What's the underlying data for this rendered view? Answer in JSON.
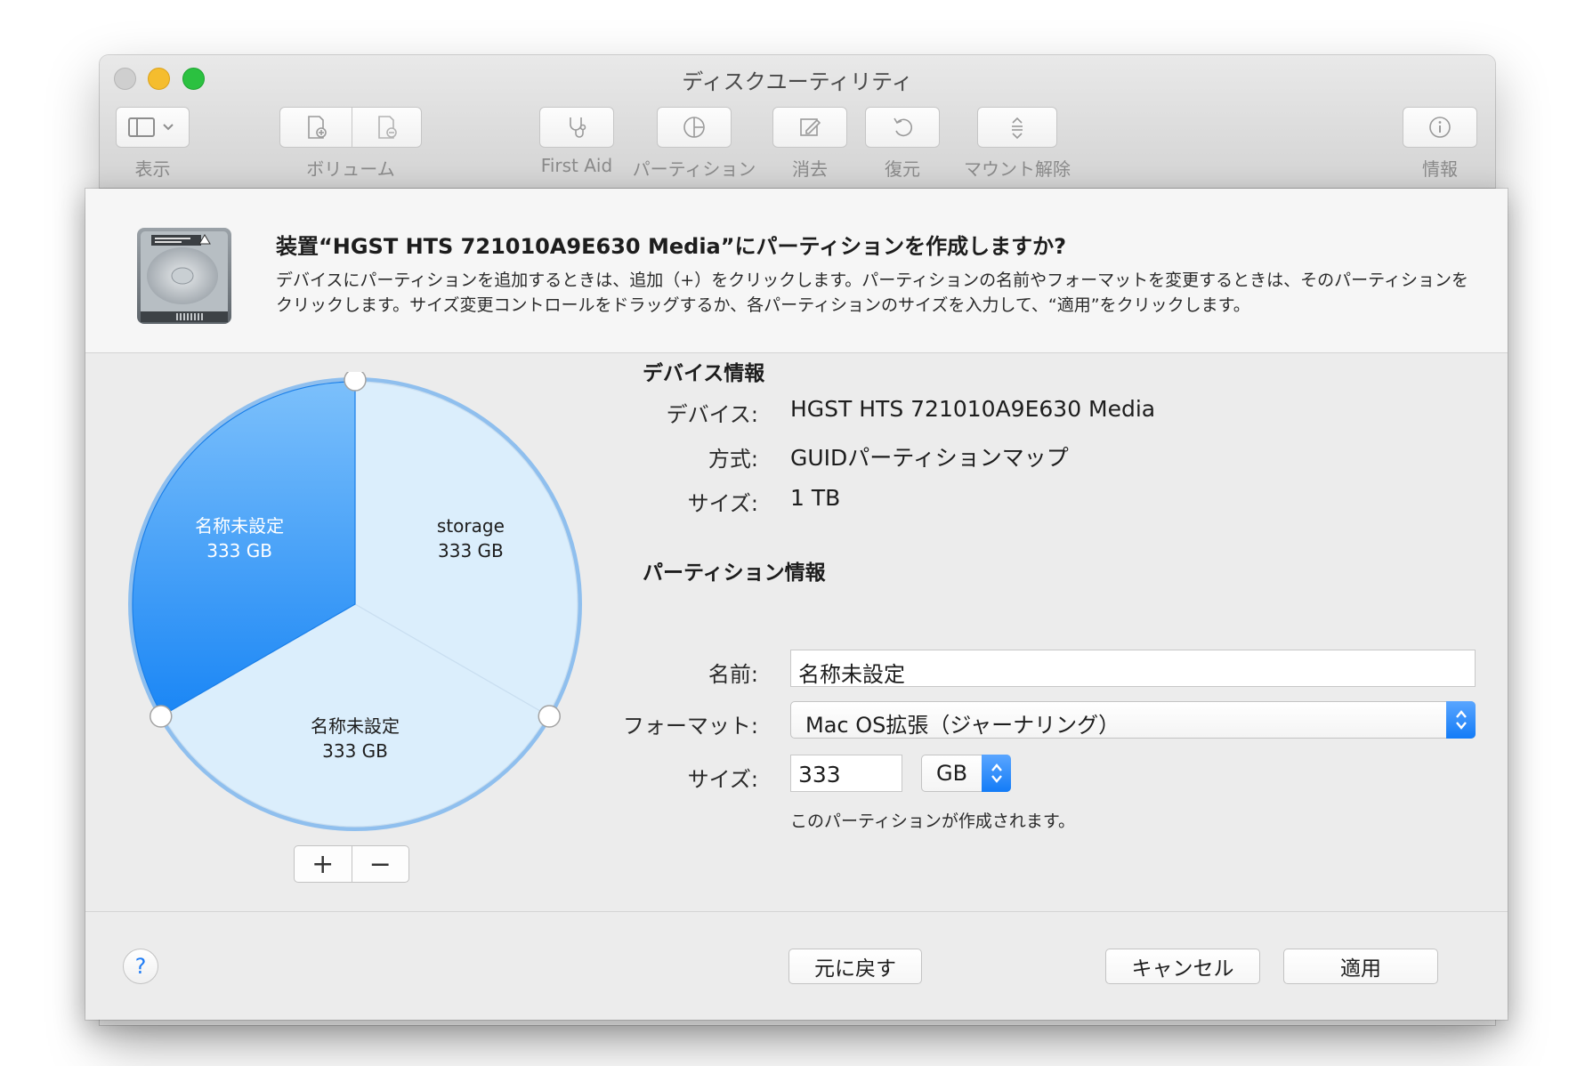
{
  "window": {
    "title": "ディスクユーティリティ"
  },
  "toolbar": {
    "view_label": "表示",
    "volume_label": "ボリューム",
    "firstaid_label": "First Aid",
    "partition_label": "パーティション",
    "erase_label": "消去",
    "restore_label": "復元",
    "unmount_label": "マウント解除",
    "info_label": "情報"
  },
  "sheet": {
    "title": "装置“HGST HTS 721010A9E630 Media”にパーティションを作成しますか?",
    "description": "デバイスにパーティションを追加するときは、追加（+）をクリックします。パーティションの名前やフォーマットを変更するときは、そのパーティションをクリックします。サイズ変更コントロールをドラッグするか、各パーティションのサイズを入力して、“適用”をクリックします。"
  },
  "chart_data": {
    "type": "pie",
    "slices": [
      {
        "name": "名称未設定",
        "size": "333 GB",
        "value": 333,
        "selected": true,
        "color": "#1a86f5"
      },
      {
        "name": "storage",
        "size": "333 GB",
        "value": 333,
        "selected": false,
        "color": "#dbeefc"
      },
      {
        "name": "名称未設定",
        "size": "333 GB",
        "value": 333,
        "selected": false,
        "color": "#dbeefc"
      }
    ]
  },
  "partition_buttons": {
    "add": "+",
    "remove": "−"
  },
  "device_info": {
    "section_title": "デバイス情報",
    "device_label": "デバイス:",
    "device_value": "HGST HTS 721010A9E630 Media",
    "scheme_label": "方式:",
    "scheme_value": "GUIDパーティションマップ",
    "size_label": "サイズ:",
    "size_value": "1 TB"
  },
  "partition_info": {
    "section_title": "パーティション情報",
    "name_label": "名前:",
    "name_value": "名称未設定",
    "format_label": "フォーマット:",
    "format_value": "Mac OS拡張（ジャーナリング）",
    "size_label": "サイズ:",
    "size_value": "333",
    "unit_value": "GB",
    "hint": "このパーティションが作成されます。"
  },
  "footer": {
    "help": "?",
    "revert": "元に戻す",
    "cancel": "キャンセル",
    "apply": "適用"
  },
  "colors": {
    "accent": "#1a86f5",
    "pie_light": "#dbeefc",
    "pie_ring": "#8fbfee"
  }
}
